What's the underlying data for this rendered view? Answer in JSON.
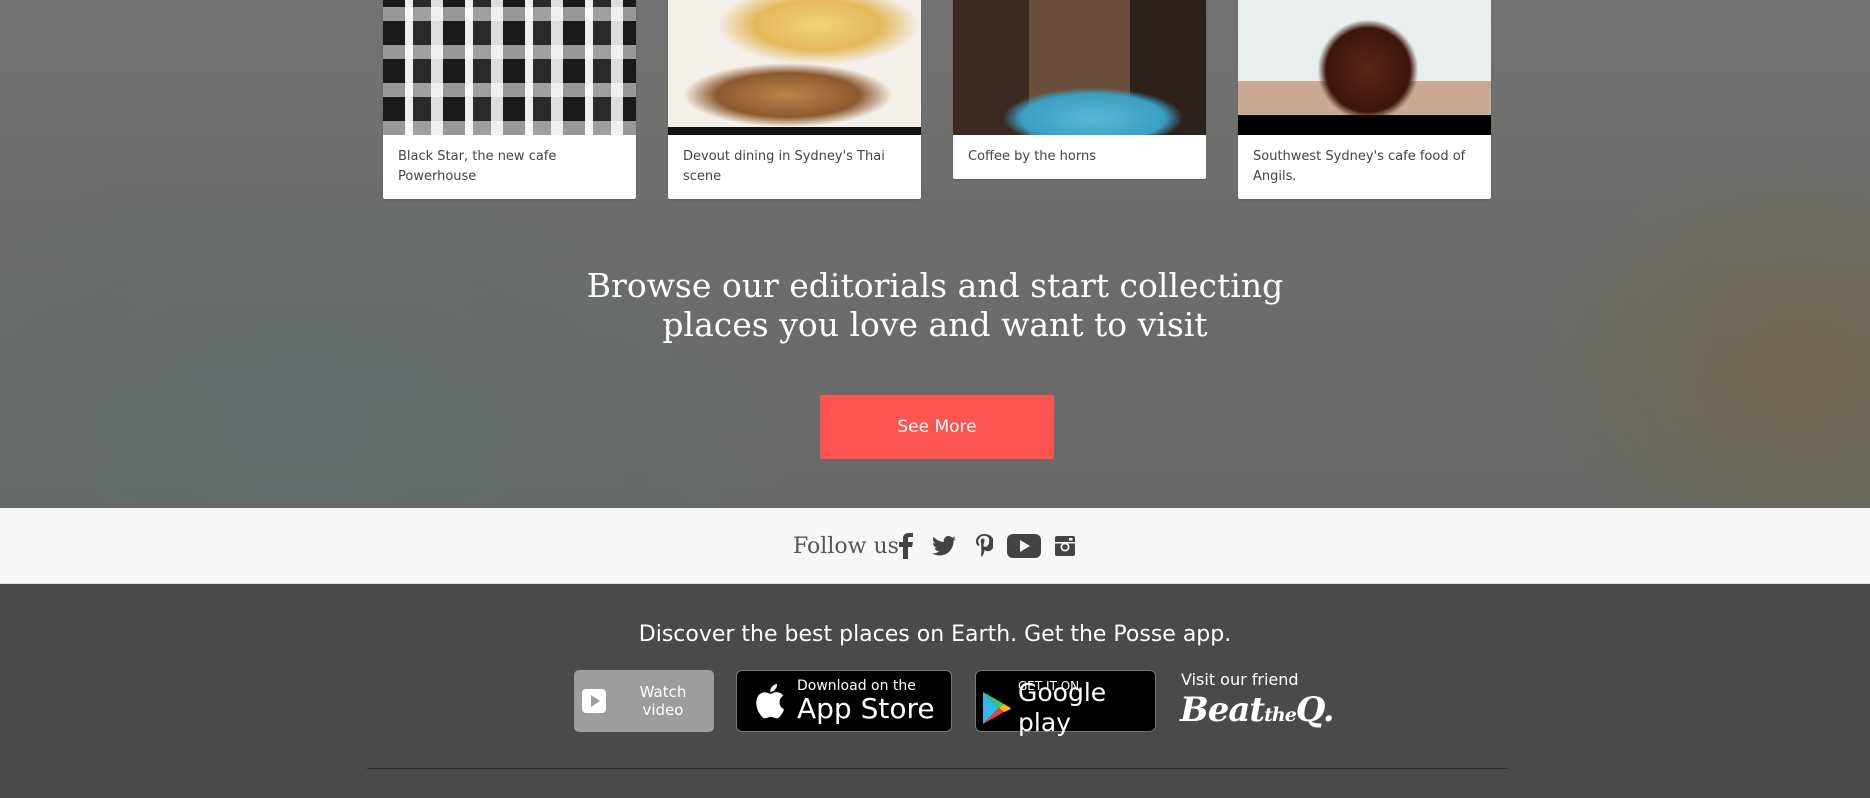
{
  "editorials": [
    {
      "title": "Black Star, the new cafe Powerhouse"
    },
    {
      "title": "Devout dining in Sydney's Thai scene"
    },
    {
      "title": "Coffee by the horns"
    },
    {
      "title": "Southwest Sydney's cafe food of Angils."
    }
  ],
  "headline": {
    "line1": "Browse our editorials and start collecting",
    "line2": "places you love and want to visit"
  },
  "see_more_label": "See More",
  "follow": {
    "label": "Follow us",
    "icons": [
      "facebook-icon",
      "twitter-icon",
      "pinterest-icon",
      "youtube-icon",
      "instagram-icon"
    ]
  },
  "footer": {
    "tagline": "Discover the best places on Earth. Get the Posse app.",
    "watch_video_label": "Watch video",
    "app_store": {
      "small": "Download on the",
      "big": "App Store"
    },
    "google_play": {
      "small": "GET IT ON",
      "big": "Google play"
    },
    "friend_label": "Visit our friend",
    "friend_logo": "Beat the Q."
  },
  "colors": {
    "accent": "#fd5452",
    "footer_bg": "#4a4a4a",
    "follow_bg": "#f7f7f7"
  }
}
